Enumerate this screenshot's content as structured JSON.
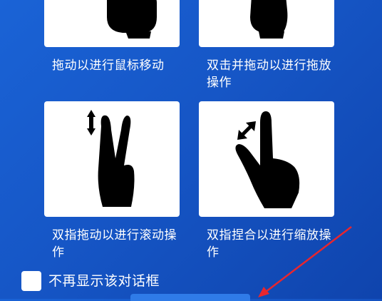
{
  "gestures": [
    {
      "caption": "拖动以进行鼠标移动",
      "icon": "one-finger-drag-icon"
    },
    {
      "caption": "双击并拖动以进行拖放操作",
      "icon": "double-tap-drag-icon"
    },
    {
      "caption": "双指拖动以进行滚动操作",
      "icon": "two-finger-scroll-icon"
    },
    {
      "caption": "双指捏合以进行缩放操作",
      "icon": "pinch-zoom-icon"
    }
  ],
  "dont_show_again": {
    "label": "不再显示该对话框",
    "checked": false
  },
  "colors": {
    "background": "#1656c6",
    "card": "#ffffff",
    "annotation_arrow": "#e8262e"
  }
}
